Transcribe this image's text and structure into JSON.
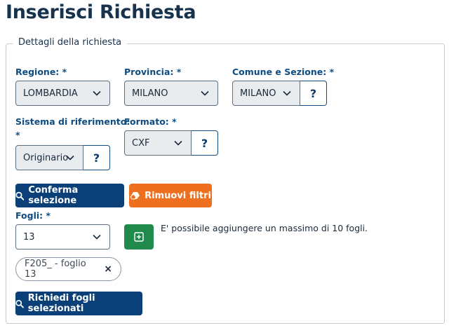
{
  "page": {
    "title": "Inserisci Richiesta"
  },
  "form": {
    "legend": "Dettagli della richiesta",
    "regione": {
      "label": "Regione: *",
      "value": "LOMBARDIA"
    },
    "provincia": {
      "label": "Provincia: *",
      "value": "MILANO"
    },
    "comune": {
      "label": "Comune e Sezione: *",
      "value": "MILANO",
      "help": "?"
    },
    "sistema": {
      "label_line1": "Sistema di riferimento:",
      "label_line2": "*",
      "value": "Originario",
      "help": "?"
    },
    "formato": {
      "label": "Formato: *",
      "value": "CXF",
      "help": "?"
    },
    "buttons": {
      "confirm": "Conferma selezione",
      "remove": "Rimuovi filtri",
      "request": "Richiedi fogli selezionati"
    },
    "fogli": {
      "label": "Fogli: *",
      "value": "13",
      "note": "E' possibile aggiungere un massimo di 10 fogli.",
      "selected": [
        {
          "label": "F205_ - foglio 13",
          "remove": "×"
        }
      ]
    }
  },
  "colors": {
    "primary": "#0b3f78",
    "orange": "#ee6f1f",
    "green": "#1f8a4c",
    "label": "#0f4c81"
  }
}
